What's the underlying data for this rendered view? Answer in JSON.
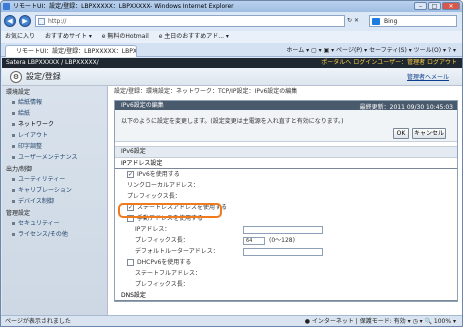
{
  "window": {
    "title": "リモートUI：設定/登録：LBPXXXXX：LBPXXXXX- Windows Internet Explorer",
    "minimize": "–",
    "maximize": "□",
    "close": "✕"
  },
  "browser": {
    "back": "◀",
    "forward": "▶",
    "address": "http://",
    "refresh": "↻",
    "stop": "✕",
    "search_engine": "Bing",
    "favorites_label": "お気に入り",
    "fav_items": [
      "おすすめサイト ▾",
      "e 無料のHotmail",
      "e 主日のおすすめアド... ▾"
    ],
    "tab_label": "リモートUI：設定/登録：LBPXXXXX：LBPXX...",
    "toolbar": "ホーム ▾  ▢ ▾  ▣ ▾  ページ(P) ▾  セーフティ(S) ▾  ツール(O) ▾  ? ▾"
  },
  "site": {
    "brand": "Satera   LBPXXXXX / LBPXXXXX/",
    "header_links": "ポータルへ  ログインユーザー：管理者  ログアウト",
    "page_title": "設定/登録",
    "manage_link": "管理者へメール"
  },
  "sidebar": {
    "sections": [
      {
        "title": "環境設定",
        "items": [
          "給紙情報",
          "給紙",
          "ネットワーク",
          "レイアウト",
          "印字調整",
          "ユーザーメンテナンス"
        ]
      },
      {
        "title": "出力/制御",
        "items": [
          "ユーティリティー",
          "キャリブレーション",
          "デバイス制御"
        ]
      },
      {
        "title": "管理設定",
        "items": [
          "セキュリティー",
          "ライセンス/その他"
        ]
      }
    ]
  },
  "main": {
    "breadcrumb": "設定/登録：環境設定：ネットワーク：TCP/IP設定：IPv6設定の編集",
    "panel_title": "IPv6設定の編集",
    "last_updated": "最終更新：2011 09/30 10:45:03",
    "message": "以下のように設定を変更します。(設定変更は主電源を入れ直すと有効になります。)",
    "ok": "OK",
    "cancel": "キャンセル",
    "section_label": "IPv6設定",
    "ipaddr_section": "IPアドレス設定",
    "use_ipv6": "IPv6を使用する",
    "link_local": "リンクローカルアドレス：",
    "prefix_len": "プレフィックス長：",
    "stateless": "ステートレスアドレスを使用する",
    "manual": "手動アドレスを使用する",
    "ip_address": "IPアドレス：",
    "prefix_len2": "プレフィックス長：",
    "prefix_value": "64",
    "prefix_range": "(0〜128)",
    "default_router": "デフォルトルーターアドレス：",
    "dhcpv6": "DHCPv6を使用する",
    "stateful": "ステートフルアドレス：",
    "prefix_len3": "プレフィックス長：",
    "dns_section": "DNS設定"
  },
  "status": {
    "left": "ページが表示されました",
    "right": "● インターネット | 保護モード: 有効    ▾ ◷ ▾  🔍 100%  ▾"
  }
}
